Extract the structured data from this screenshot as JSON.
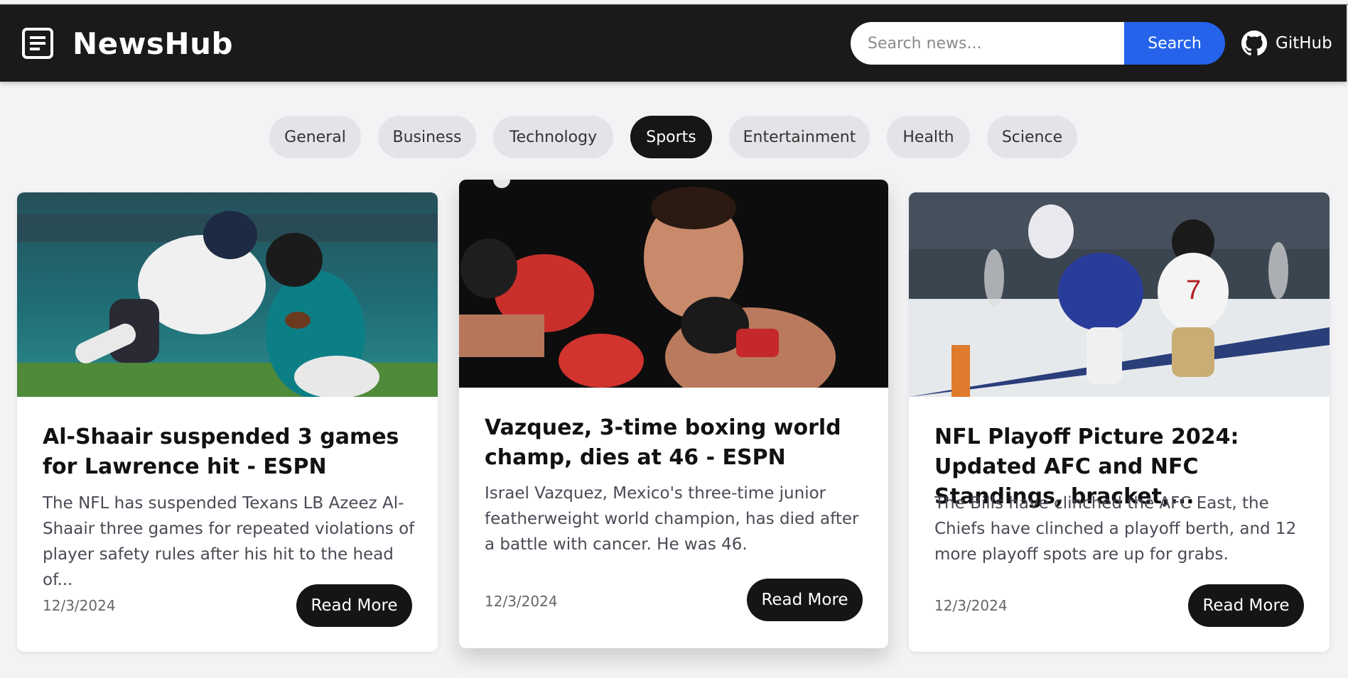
{
  "header": {
    "app_title": "NewsHub",
    "logo_icon": "newspaper-icon",
    "search": {
      "placeholder": "Search news...",
      "button_label": "Search"
    },
    "github": {
      "label": "GitHub",
      "icon": "github-icon"
    },
    "accent_color": "#2563eb"
  },
  "categories": {
    "items": [
      "General",
      "Business",
      "Technology",
      "Sports",
      "Entertainment",
      "Health",
      "Science"
    ],
    "active": "Sports"
  },
  "articles": [
    {
      "title": "Al-Shaair suspended 3 games for Lawrence hit - ESPN",
      "description": "The NFL has suspended Texans LB Azeez Al-Shaair three games for repeated violations of player safety rules after his hit to the head of...",
      "date": "12/3/2024",
      "read_more": "Read More",
      "image": "football-tackle-photo"
    },
    {
      "title": "Vazquez, 3-time boxing world champ, dies at 46 - ESPN",
      "description": "Israel Vazquez, Mexico's three-time junior featherweight world champion, has died after a battle with cancer. He was 46.",
      "date": "12/3/2024",
      "read_more": "Read More",
      "image": "boxing-punch-photo"
    },
    {
      "title": "NFL Playoff Picture 2024: Updated AFC and NFC Standings, bracket,...",
      "description": "The Bills have clinched the AFC East, the Chiefs have clinched a playoff berth, and 12 more playoff spots are up for grabs.",
      "date": "12/3/2024",
      "read_more": "Read More",
      "image": "snow-football-photo"
    }
  ]
}
